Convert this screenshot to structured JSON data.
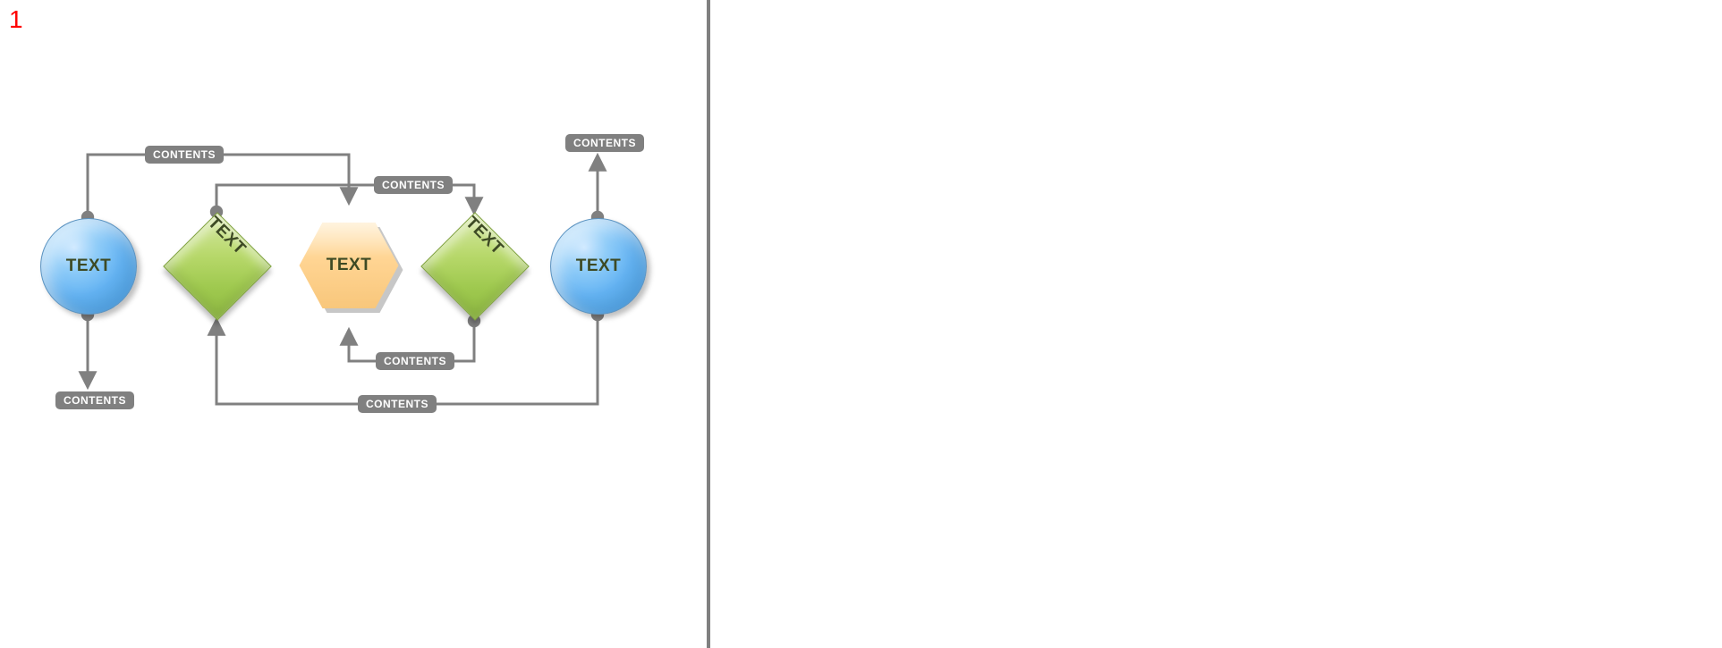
{
  "page_number": "1",
  "nodes": {
    "n1": {
      "label": "TEXT"
    },
    "n2": {
      "label": "TEXT"
    },
    "n3": {
      "label": "TEXT"
    },
    "n4": {
      "label": "TEXT"
    },
    "n5": {
      "label": "TEXT"
    }
  },
  "edge_labels": {
    "top_left": "CONTENTS",
    "top_mid": "CONTENTS",
    "top_right": "CONTENTS",
    "bottom_left": "CONTENTS",
    "bottom_mid_upper": "CONTENTS",
    "bottom_mid_lower": "CONTENTS"
  },
  "colors": {
    "line": "#808080",
    "pill_bg": "#808080",
    "pill_fg": "#ffffff",
    "page_number": "#ff0000"
  }
}
